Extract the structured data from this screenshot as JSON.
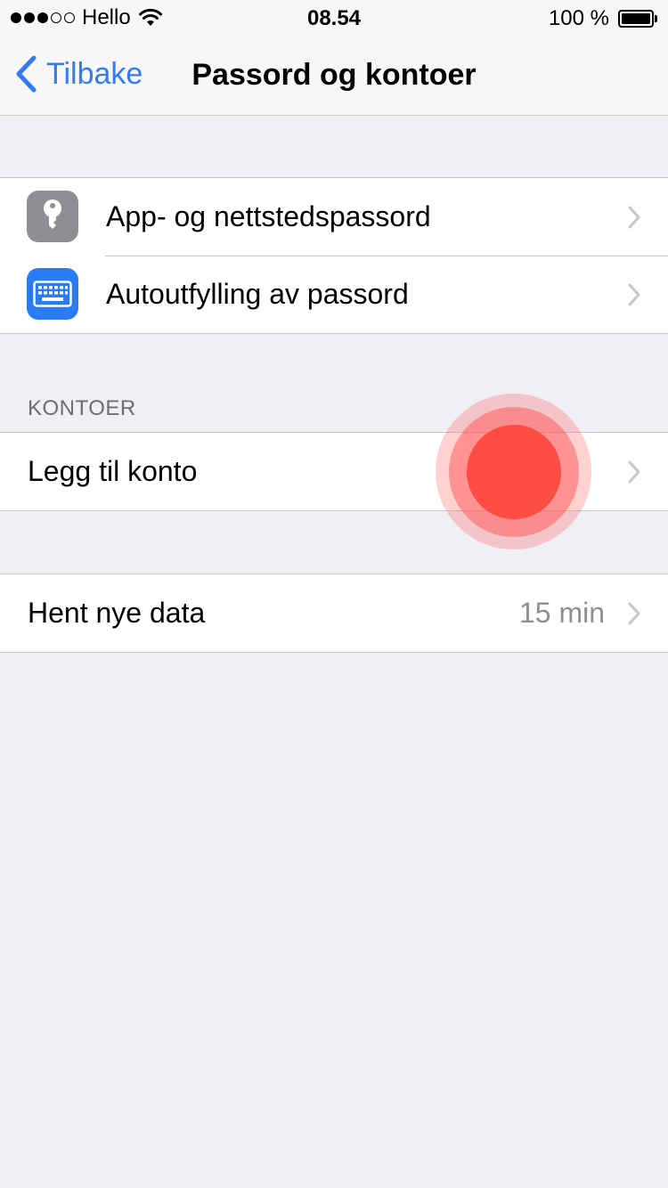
{
  "status_bar": {
    "carrier": "Hello",
    "time": "08.54",
    "battery_percent": "100 %",
    "signal_strength": 3,
    "signal_max": 5,
    "battery_level": 1.0,
    "icons": {
      "wifi": "wifi-icon",
      "battery": "battery-icon"
    }
  },
  "nav": {
    "back_label": "Tilbake",
    "title": "Passord og kontoer",
    "back_icon": "chevron-left-icon"
  },
  "passwords_group": {
    "items": [
      {
        "label": "App- og nettstedspassord",
        "icon": "key-icon",
        "icon_color": "#8e8e93"
      },
      {
        "label": "Autoutfylling av passord",
        "icon": "keyboard-icon",
        "icon_color": "#2c7bf6"
      }
    ]
  },
  "accounts_section": {
    "header": "KONTOER",
    "add_account_label": "Legg til konto"
  },
  "fetch_group": {
    "label": "Hent nye data",
    "value": "15 min"
  },
  "colors": {
    "accent": "#2f7cf6",
    "background": "#efeff4",
    "separator": "#c8c7cc",
    "touch_indicator": "#ff4c44"
  }
}
